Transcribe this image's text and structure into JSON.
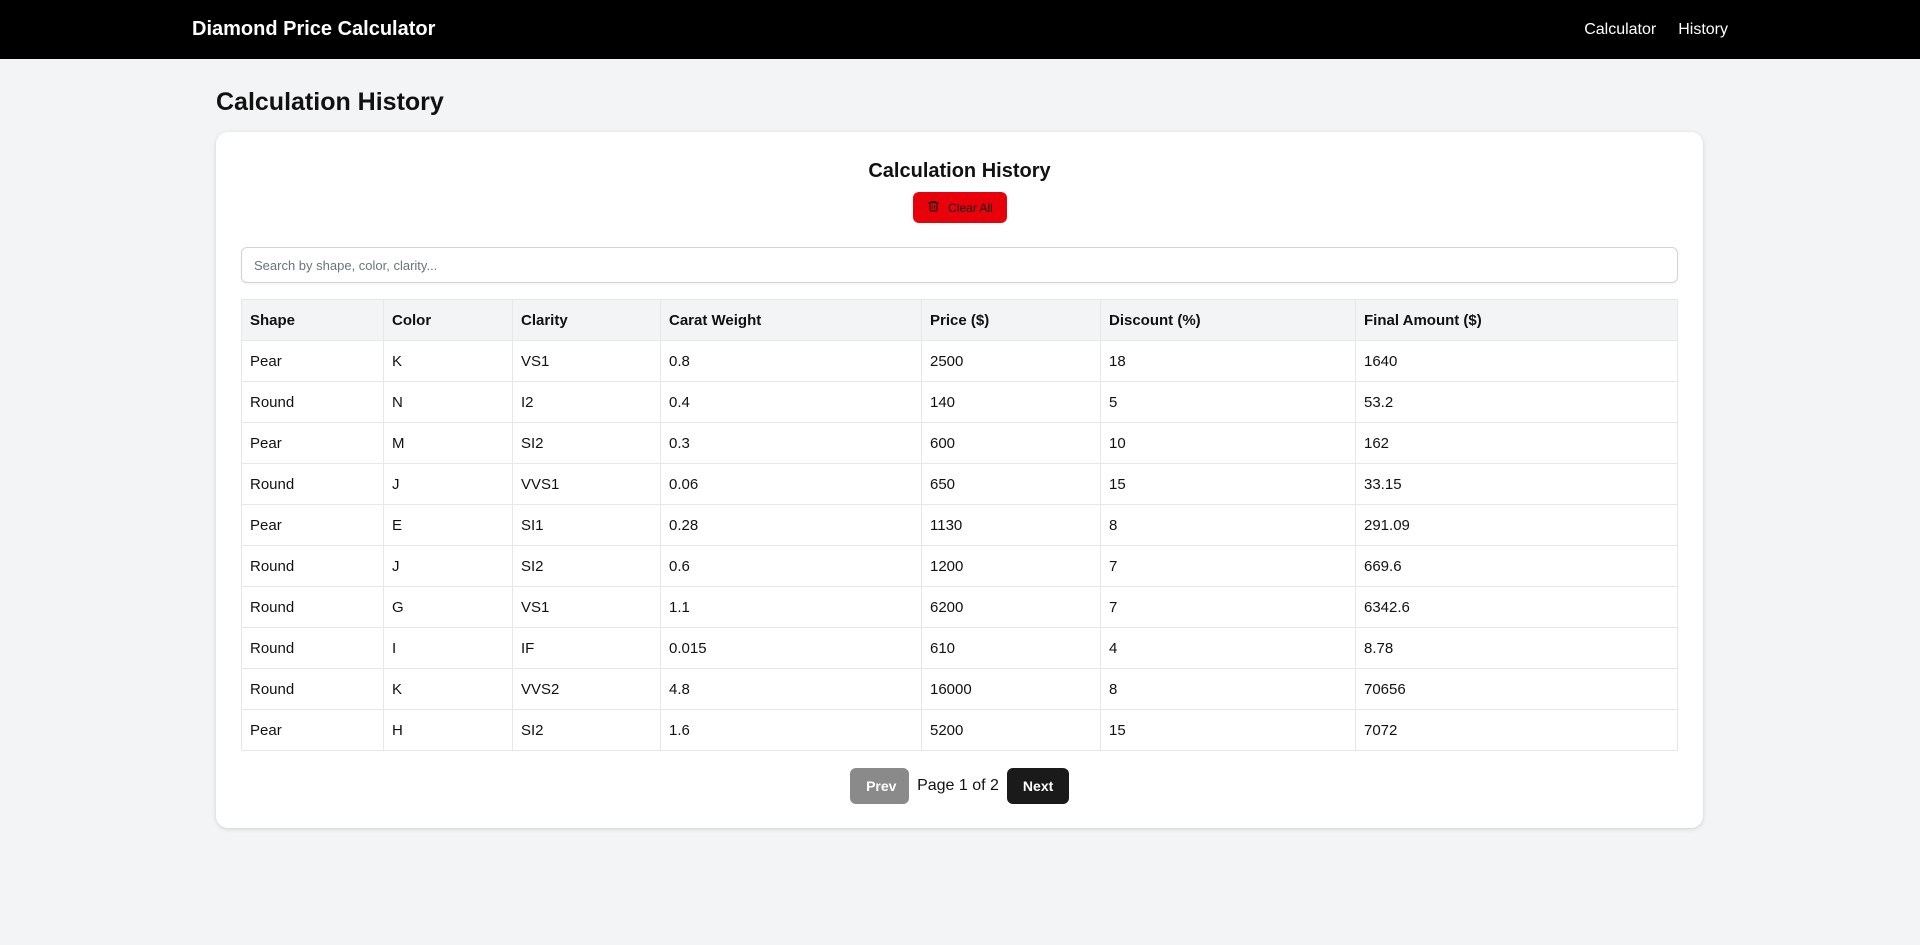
{
  "nav": {
    "brand": "Diamond Price Calculator",
    "links": [
      "Calculator",
      "History"
    ]
  },
  "page_title": "Calculation History",
  "card": {
    "title": "Calculation History",
    "clear_label": "Clear All",
    "search_placeholder": "Search by shape, color, clarity..."
  },
  "table": {
    "headers": [
      "Shape",
      "Color",
      "Clarity",
      "Carat Weight",
      "Price ($)",
      "Discount (%)",
      "Final Amount ($)"
    ],
    "rows": [
      [
        "Pear",
        "K",
        "VS1",
        "0.8",
        "2500",
        "18",
        "1640"
      ],
      [
        "Round",
        "N",
        "I2",
        "0.4",
        "140",
        "5",
        "53.2"
      ],
      [
        "Pear",
        "M",
        "SI2",
        "0.3",
        "600",
        "10",
        "162"
      ],
      [
        "Round",
        "J",
        "VVS1",
        "0.06",
        "650",
        "15",
        "33.15"
      ],
      [
        "Pear",
        "E",
        "SI1",
        "0.28",
        "1130",
        "8",
        "291.09"
      ],
      [
        "Round",
        "J",
        "SI2",
        "0.6",
        "1200",
        "7",
        "669.6"
      ],
      [
        "Round",
        "G",
        "VS1",
        "1.1",
        "6200",
        "7",
        "6342.6"
      ],
      [
        "Round",
        "I",
        "IF",
        "0.015",
        "610",
        "4",
        "8.78"
      ],
      [
        "Round",
        "K",
        "VVS2",
        "4.8",
        "16000",
        "8",
        "70656"
      ],
      [
        "Pear",
        "H",
        "SI2",
        "1.6",
        "5200",
        "15",
        "7072"
      ]
    ]
  },
  "pagination": {
    "prev_label": "Prev",
    "info": "Page 1 of 2",
    "next_label": "Next"
  },
  "colors": {
    "navbar": "#000000",
    "clear_button": "#e8000b",
    "background": "#f3f4f6"
  },
  "icons": {
    "clear": "trash-icon"
  }
}
